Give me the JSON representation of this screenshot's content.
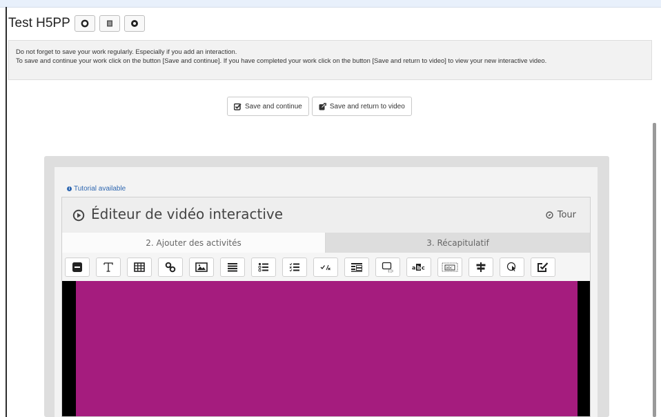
{
  "page": {
    "title": "Test H5PP"
  },
  "notice": {
    "line1": "Do not forget to save your work regularly. Especially if you add an interaction.",
    "line2": "To save and continue your work click on the button [Save and continue]. If you have completed your work click on the button [Save and return to video] to view your new interactive video."
  },
  "actions": {
    "save_continue": "Save and continue",
    "save_return": "Save and return to video"
  },
  "editor": {
    "tutorial_link": "Tutorial available",
    "title": "Éditeur de vidéo interactive",
    "tour": "Tour",
    "tabs": [
      "2. Ajouter des activités",
      "3. Récapitulatif"
    ],
    "tools": [
      "label",
      "text",
      "table",
      "link",
      "image",
      "statements",
      "single-choice-set",
      "multiple-choice",
      "true-false",
      "drag-and-drop",
      "drag-the-words",
      "mark-the-words",
      "fill-in-the-blanks",
      "crossroads",
      "navigation-hotspot",
      "questionnaire"
    ]
  },
  "colors": {
    "video_bg": "#a51c7e",
    "link": "#2d66b0"
  }
}
